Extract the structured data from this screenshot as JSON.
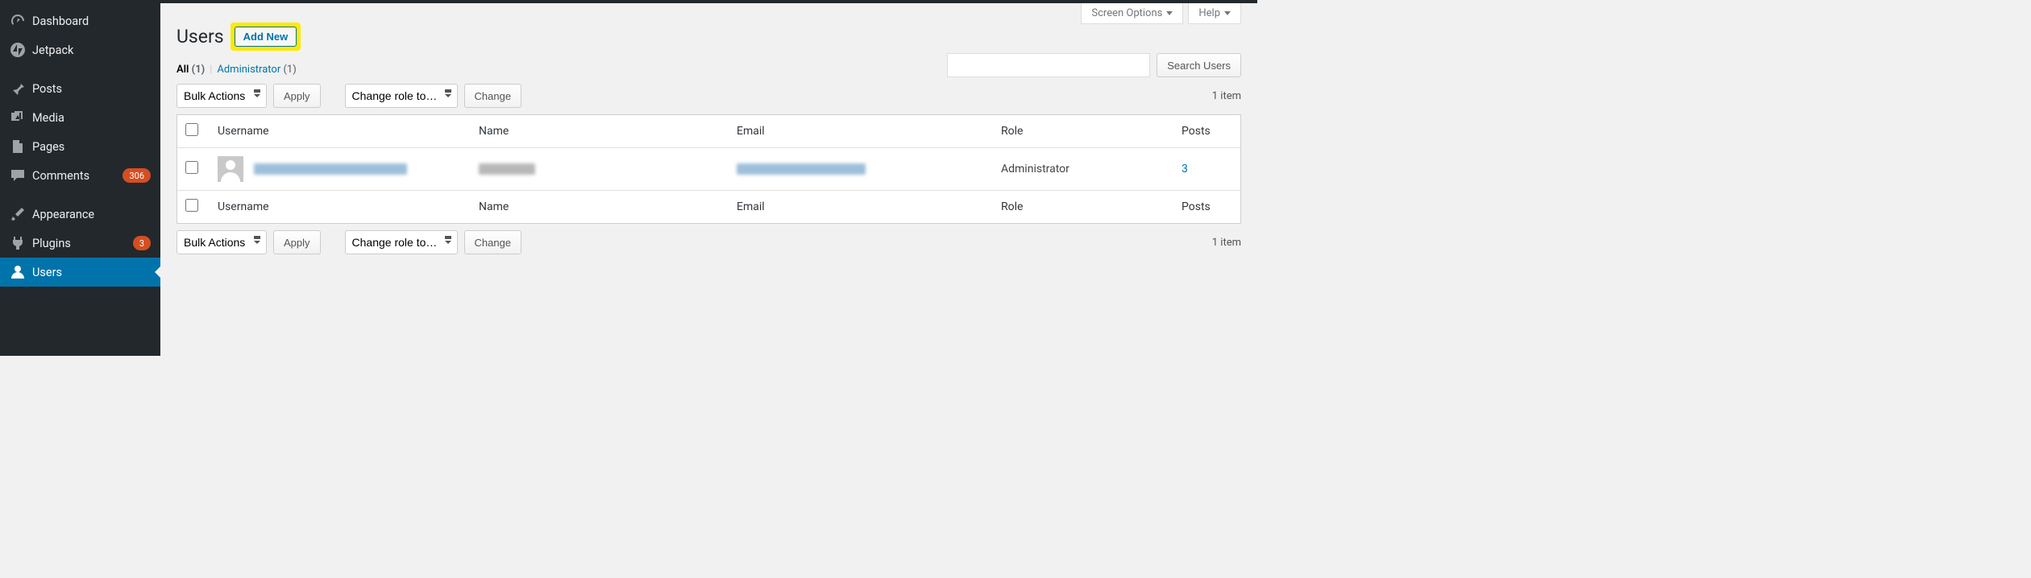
{
  "sidebar": {
    "items": [
      {
        "icon": "gauge",
        "label": "Dashboard"
      },
      {
        "icon": "jetpack",
        "label": "Jetpack"
      },
      {
        "icon": "pin",
        "label": "Posts"
      },
      {
        "icon": "media",
        "label": "Media"
      },
      {
        "icon": "page",
        "label": "Pages"
      },
      {
        "icon": "comment",
        "label": "Comments",
        "badge": "306"
      },
      {
        "icon": "brush",
        "label": "Appearance"
      },
      {
        "icon": "plug",
        "label": "Plugins",
        "badge": "3"
      },
      {
        "icon": "user",
        "label": "Users",
        "current": true
      }
    ]
  },
  "screen_meta": {
    "screen_options": "Screen Options",
    "help": "Help"
  },
  "heading": {
    "title": "Users",
    "add_new": "Add New"
  },
  "filters": {
    "all_label": "All",
    "all_count": "(1)",
    "admin_label": "Administrator",
    "admin_count": "(1)"
  },
  "search": {
    "button": "Search Users"
  },
  "actions": {
    "bulk_label": "Bulk Actions",
    "apply": "Apply",
    "role_label": "Change role to…",
    "change": "Change",
    "items": "1 item"
  },
  "table": {
    "headers": {
      "username": "Username",
      "name": "Name",
      "email": "Email",
      "role": "Role",
      "posts": "Posts"
    },
    "rows": [
      {
        "role": "Administrator",
        "posts": "3"
      }
    ]
  }
}
